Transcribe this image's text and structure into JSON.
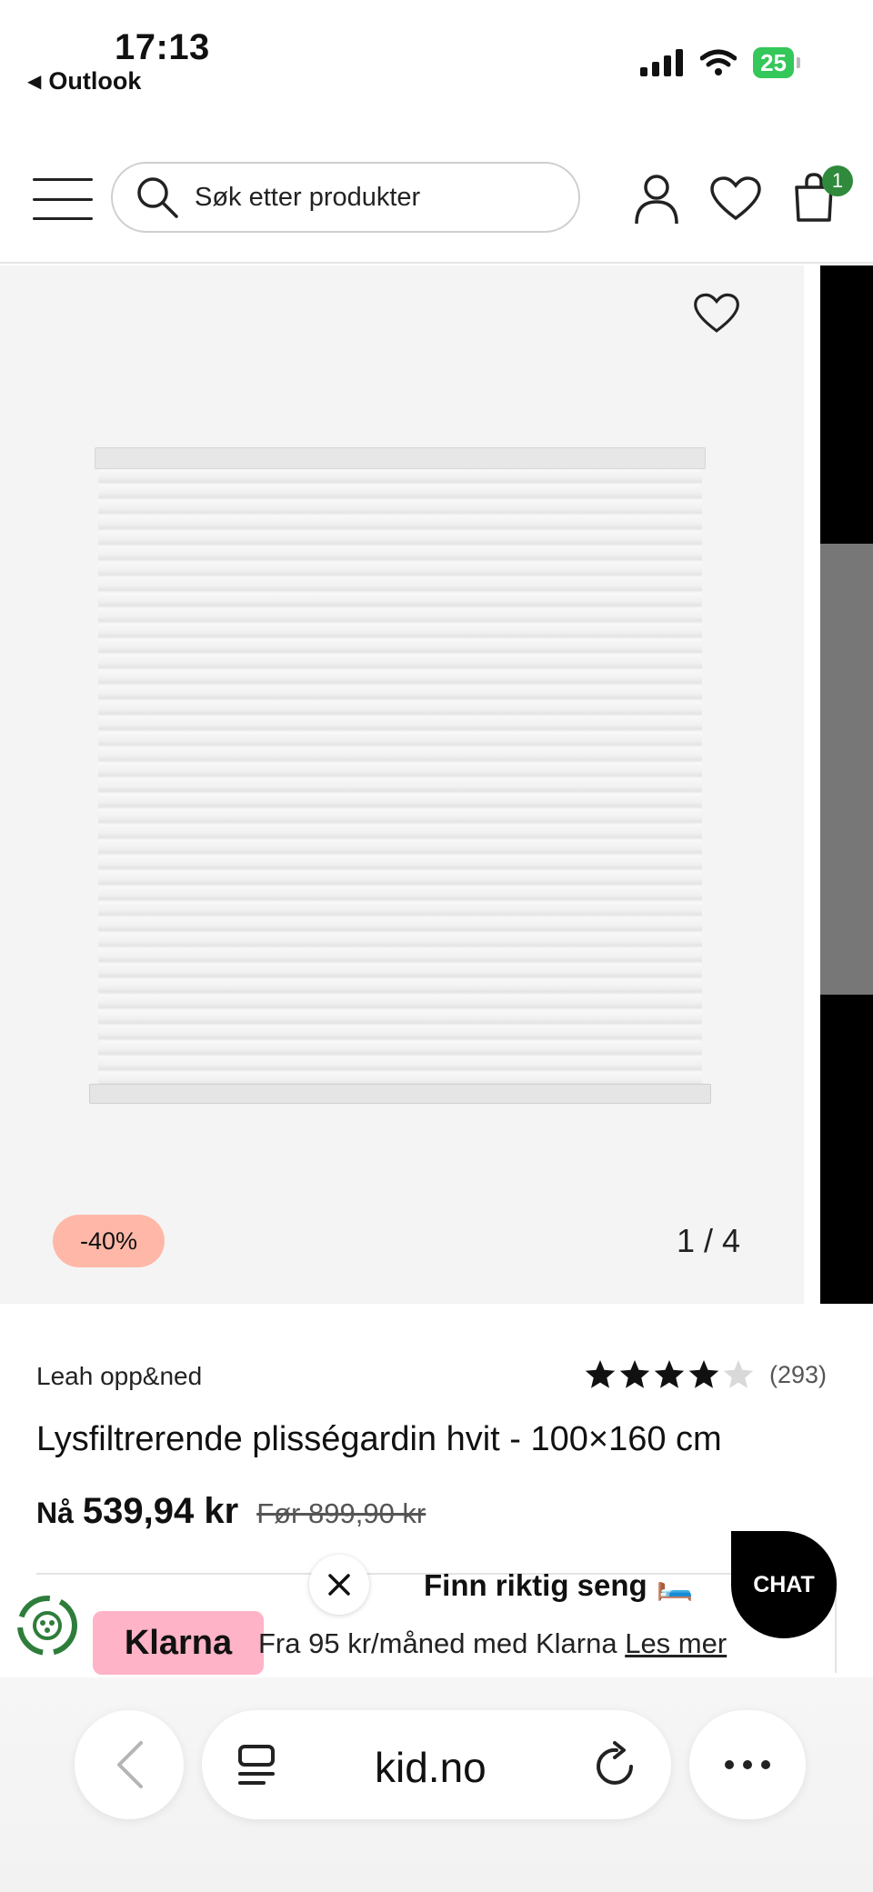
{
  "status_bar": {
    "time": "17:13",
    "back_app": "Outlook",
    "battery": "25"
  },
  "header": {
    "search_placeholder": "Søk etter produkter",
    "cart_count": "1"
  },
  "gallery": {
    "discount": "-40%",
    "pager": "1 / 4"
  },
  "product": {
    "brand": "Leah opp&ned",
    "rating_value": 4,
    "rating_max": 5,
    "rating_count": "(293)",
    "title": "Lysfiltrerende plisségardin hvit - 100×160 cm",
    "price_now_label": "Nå",
    "price_now": "539,94 kr",
    "price_before": "Før 899,90 kr"
  },
  "klarna": {
    "logo": "Klarna",
    "text": "Fra 95 kr/måned med Klarna",
    "link": "Les mer"
  },
  "promo": {
    "text": "Finn riktig seng",
    "emoji": "🛏️",
    "chat": "CHAT"
  },
  "browser": {
    "url": "kid.no"
  },
  "colors": {
    "accent_green": "#2f8a3c",
    "discount_bg": "#ffb8a8",
    "klarna_pink": "#ffb3c7"
  }
}
